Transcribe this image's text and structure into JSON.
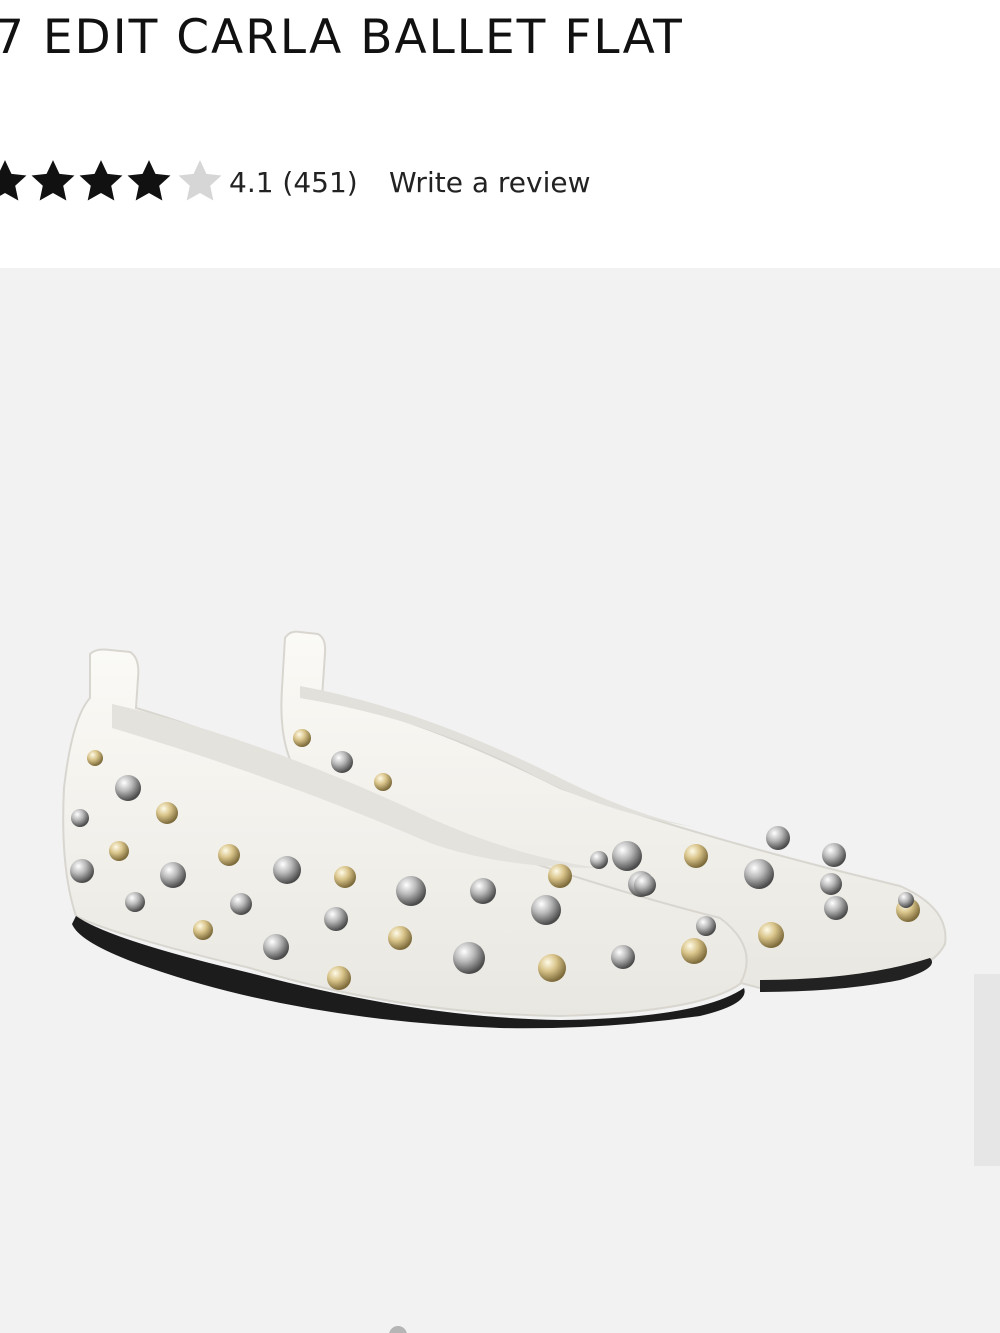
{
  "product": {
    "title": "7 EDIT CARLA BALLET FLAT"
  },
  "rating": {
    "stars_filled": 4.1,
    "stars_total": 5,
    "value_text": "4.1 (451)",
    "review_link_label": "Write a review",
    "star_color": "#111111",
    "star_empty_color": "#d6d6d6"
  },
  "gallery": {
    "background_color": "#f2f2f2",
    "image_icon": "product-photo-white-studded-ballet-flats",
    "next_control_icon": "next-slide-tab"
  }
}
